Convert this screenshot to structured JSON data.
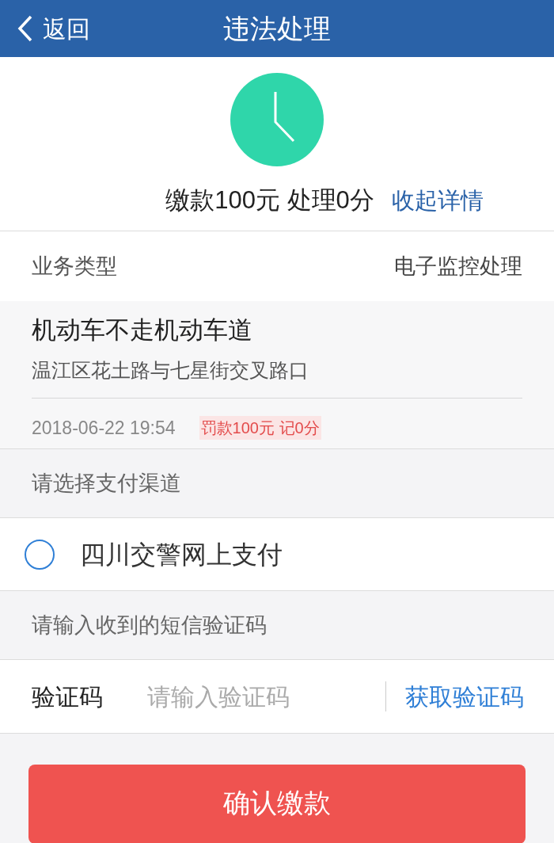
{
  "nav": {
    "back": "返回",
    "title": "违法处理"
  },
  "summary": {
    "text": "缴款100元 处理0分",
    "toggle": "收起详情"
  },
  "business": {
    "label": "业务类型",
    "value": "电子监控处理"
  },
  "violation": {
    "title": "机动车不走机动车道",
    "location": "温江区花土路与七星街交叉路口",
    "time": "2018-06-22 19:54",
    "penalty": "罚款100元 记0分"
  },
  "payment": {
    "heading": "请选择支付渠道",
    "options": [
      {
        "label": "四川交警网上支付",
        "selected": false
      }
    ]
  },
  "sms": {
    "heading": "请输入收到的短信验证码",
    "label": "验证码",
    "placeholder": "请输入验证码",
    "get_code": "获取验证码"
  },
  "confirm": "确认缴款"
}
